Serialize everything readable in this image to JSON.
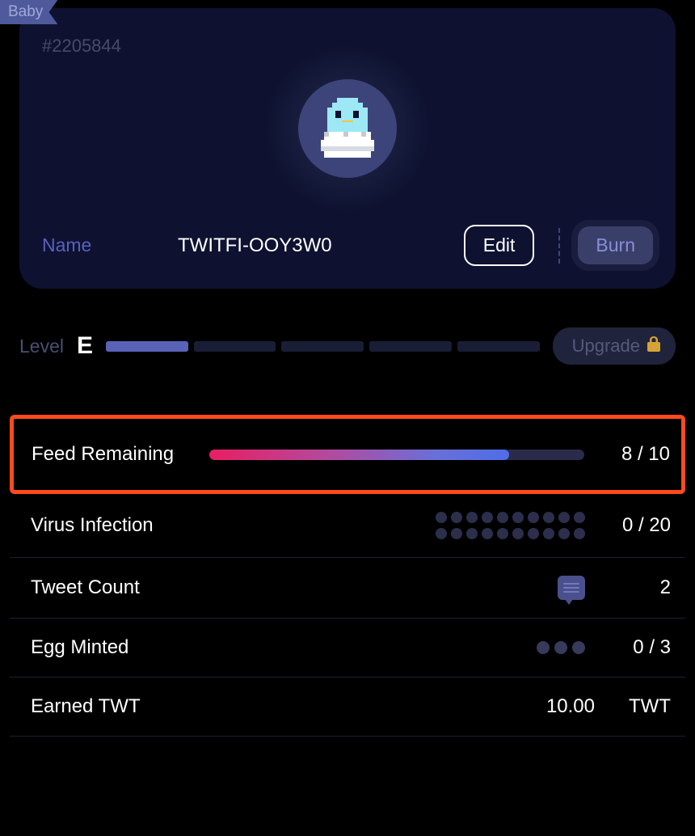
{
  "ribbon": "Baby",
  "card": {
    "id": "#2205844",
    "name_label": "Name",
    "name_value": "TWITFI-OOY3W0",
    "edit_label": "Edit",
    "burn_label": "Burn"
  },
  "level": {
    "label": "Level",
    "letter": "E",
    "filled": 1,
    "total": 5,
    "upgrade_label": "Upgrade"
  },
  "stats": {
    "feed": {
      "label": "Feed Remaining",
      "value": "8 / 10",
      "pct": 80
    },
    "virus": {
      "label": "Virus Infection",
      "value": "0 / 20",
      "total": 20
    },
    "tweet": {
      "label": "Tweet Count",
      "value": "2"
    },
    "egg": {
      "label": "Egg Minted",
      "value": "0 / 3",
      "total": 3
    },
    "earned": {
      "label": "Earned TWT",
      "value": "10.00",
      "unit": "TWT"
    }
  }
}
